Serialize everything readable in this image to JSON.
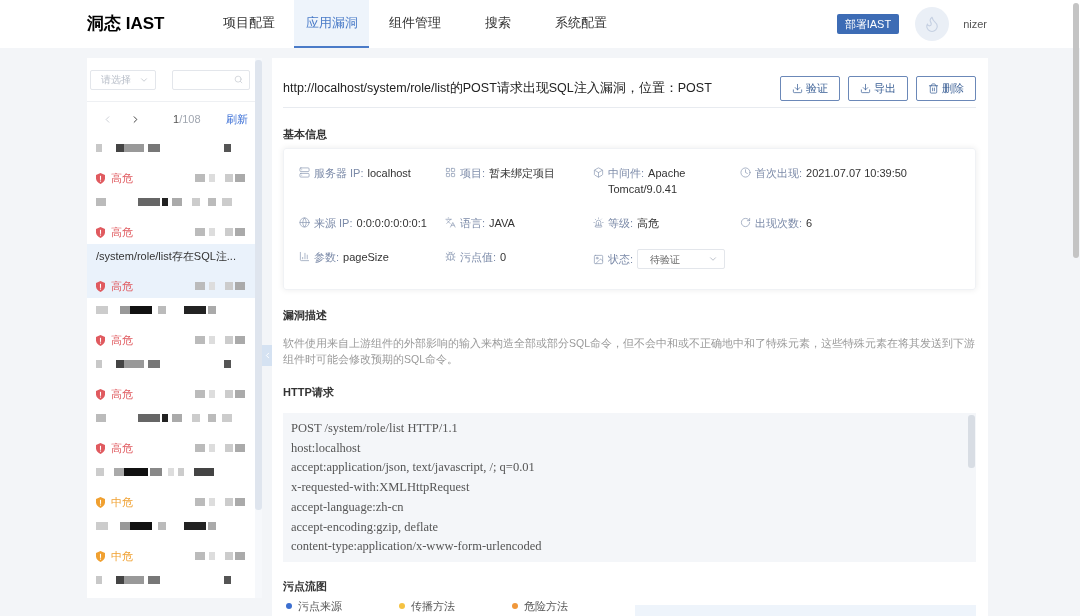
{
  "header": {
    "logo": "洞态 IAST",
    "nav": [
      {
        "label": "项目配置",
        "selected": false
      },
      {
        "label": "应用漏洞",
        "selected": true
      },
      {
        "label": "组件管理",
        "selected": false
      },
      {
        "label": "搜索",
        "selected": false
      },
      {
        "label": "系统配置",
        "selected": false
      }
    ],
    "deploy_button": "部署IAST",
    "user": "nizer"
  },
  "sidebar": {
    "filter": {
      "placeholder": "请选择"
    },
    "pagination": {
      "prev_disabled": true,
      "next_disabled": false,
      "current": "1",
      "total": "/108",
      "refresh": "刷新"
    },
    "items": [
      {
        "severity": "高危",
        "color": "#e05a5f",
        "selected": false
      },
      {
        "severity": "高危",
        "color": "#e05a5f",
        "selected": false
      },
      {
        "title": "/system/role/list存在SQL注...",
        "severity": "高危",
        "color": "#e05a5f",
        "selected": true
      },
      {
        "severity": "高危",
        "color": "#e05a5f",
        "selected": false
      },
      {
        "severity": "高危",
        "color": "#e05a5f",
        "selected": false
      },
      {
        "severity": "高危",
        "color": "#e05a5f",
        "selected": false
      },
      {
        "severity": "中危",
        "color": "#f0a030",
        "selected": false
      },
      {
        "severity": "中危",
        "color": "#f0a030",
        "selected": false
      },
      {
        "selected": false
      }
    ]
  },
  "detail": {
    "title": "http://localhost/system/role/list的POST请求出现SQL注入漏洞，位置：POST",
    "actions": [
      "验证",
      "导出",
      "删除"
    ],
    "basic_info": {
      "heading": "基本信息",
      "fields": [
        {
          "kind": "text",
          "label": "服务器 IP:",
          "value": "localhost"
        },
        {
          "kind": "text",
          "label": "项目:",
          "value": "暂未绑定项目"
        },
        {
          "kind": "text",
          "label": "中间件:",
          "value": "Apache Tomcat/9.0.41"
        },
        {
          "kind": "text",
          "label": "首次出现:",
          "value": "2021.07.07 10:39:50"
        },
        {
          "kind": "text",
          "label": "来源 IP:",
          "value": "0:0:0:0:0:0:0:1"
        },
        {
          "kind": "text",
          "label": "语言:",
          "value": "JAVA"
        },
        {
          "kind": "text",
          "label": "等级:",
          "value": "高危"
        },
        {
          "kind": "text",
          "label": "出现次数:",
          "value": "6"
        },
        {
          "kind": "text",
          "label": "参数:",
          "value": "pageSize"
        },
        {
          "kind": "text",
          "label": "污点值:",
          "value": "0"
        },
        {
          "kind": "select",
          "label": "状态:",
          "value": "待验证"
        }
      ]
    },
    "description": {
      "heading": "漏洞描述",
      "text": "软件使用来自上游组件的外部影响的输入来构造全部或部分SQL命令，但不会中和或不正确地中和了特殊元素，这些特殊元素在将其发送到下游组件时可能会修改预期的SQL命令。"
    },
    "http_request": {
      "heading": "HTTP请求",
      "lines": [
        "POST /system/role/list HTTP/1.1",
        "host:localhost",
        "accept:application/json, text/javascript, /; q=0.01",
        "x-requested-with:XMLHttpRequest",
        "accept-language:zh-cn",
        "accept-encoding:gzip, deflate",
        "content-type:application/x-www-form-urlencoded"
      ]
    },
    "taint_flow": {
      "heading": "污点流图",
      "legend": [
        {
          "label": "污点来源",
          "color": "#3c6fd0"
        },
        {
          "label": "传播方法",
          "color": "#f5c242"
        },
        {
          "label": "危险方法",
          "color": "#f0973a"
        }
      ]
    }
  }
}
